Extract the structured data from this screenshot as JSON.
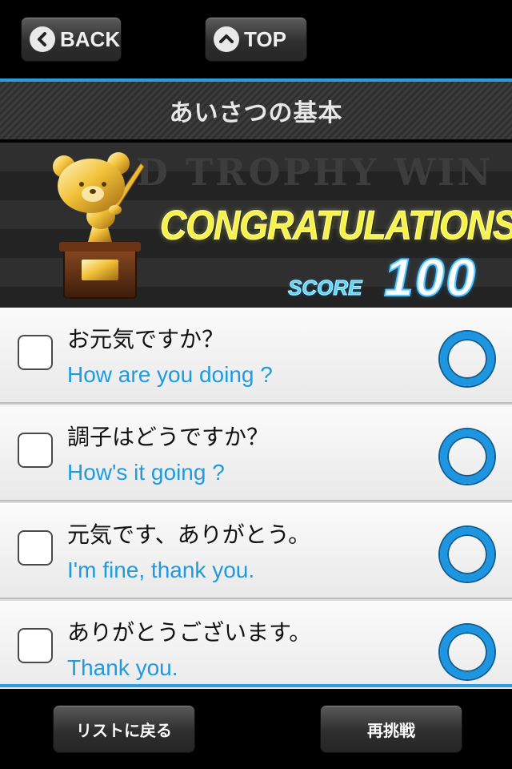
{
  "nav": {
    "back_label": "BACK",
    "top_label": "TOP"
  },
  "header": {
    "title": "あいさつの基本"
  },
  "banner": {
    "background_text": "D TROPHY WIN",
    "congrats_text": "CONGRATULATIONS",
    "score_label": "SCORE",
    "score_value": "100",
    "trophy_icon": "gold-bear-trophy-icon"
  },
  "items": [
    {
      "japanese": "お元気ですか？",
      "english": "How are you doing ?",
      "checked": false,
      "result": "correct-circle"
    },
    {
      "japanese": "調子はどうですか？",
      "english": "How's it going ?",
      "checked": false,
      "result": "correct-circle"
    },
    {
      "japanese": "元気です、ありがとう。",
      "english": "I'm fine, thank you.",
      "checked": false,
      "result": "correct-circle"
    },
    {
      "japanese": "ありがとうございます。",
      "english": "Thank you.",
      "checked": false,
      "result": "correct-circle"
    }
  ],
  "footer": {
    "back_to_list_label": "リストに戻る",
    "retry_label": "再挑戦"
  },
  "colors": {
    "accent_blue": "#2a9ee0",
    "congrats_yellow": "#f7f246",
    "score_blue": "#59d2ff"
  }
}
